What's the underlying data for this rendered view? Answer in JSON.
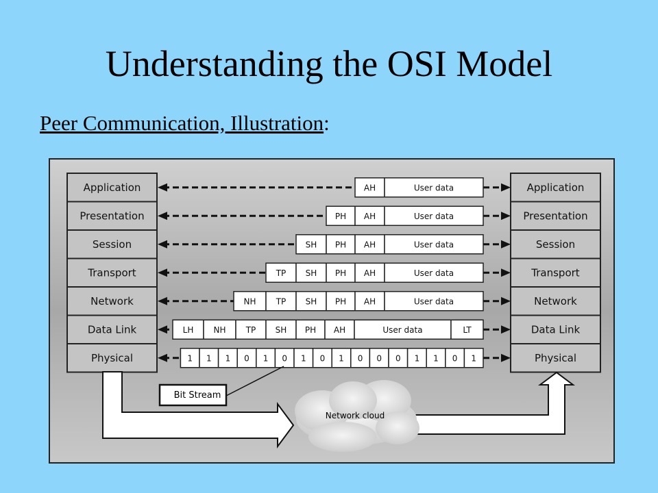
{
  "slide": {
    "title": "Understanding the OSI Model",
    "subtitle": "Peer Communication, Illustration",
    "subtitle_suffix": ":"
  },
  "colors": {
    "background": "#8dd5fb",
    "panel": "#b8b8b8",
    "layer_box": "#c4c4c4"
  },
  "diagram": {
    "layers": [
      "Application",
      "Presentation",
      "Session",
      "Transport",
      "Network",
      "Data Link",
      "Physical"
    ],
    "rows": [
      [
        "AH",
        "User data"
      ],
      [
        "PH",
        "AH",
        "User data"
      ],
      [
        "SH",
        "PH",
        "AH",
        "User data"
      ],
      [
        "TP",
        "SH",
        "PH",
        "AH",
        "User data"
      ],
      [
        "NH",
        "TP",
        "SH",
        "PH",
        "AH",
        "User data"
      ],
      [
        "LH",
        "NH",
        "TP",
        "SH",
        "PH",
        "AH",
        "User data",
        "LT"
      ],
      [
        "1",
        "1",
        "1",
        "0",
        "1",
        "0",
        "1",
        "0",
        "1",
        "0",
        "0",
        "0",
        "1",
        "1",
        "0",
        "1"
      ]
    ],
    "bit_stream_label": "Bit Stream",
    "cloud_label": "Network cloud"
  }
}
